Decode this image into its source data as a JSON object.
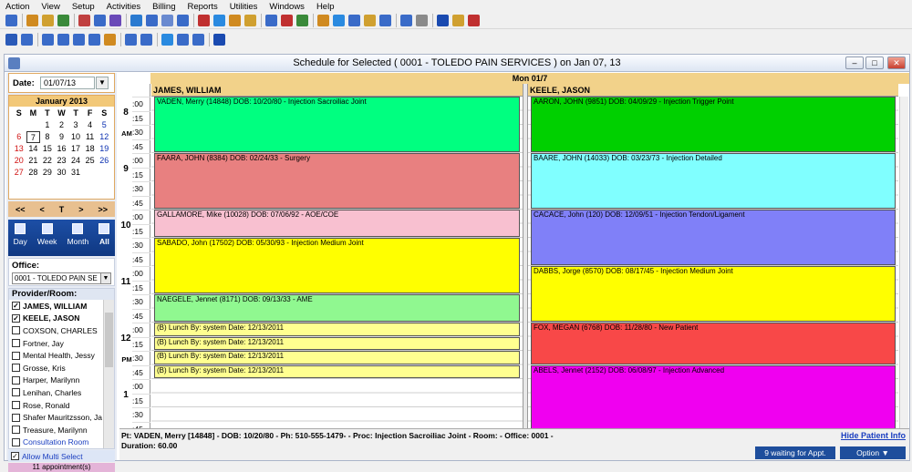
{
  "menu": [
    "Action",
    "View",
    "Setup",
    "Activities",
    "Billing",
    "Reports",
    "Utilities",
    "Windows",
    "Help"
  ],
  "window": {
    "title": "Schedule for Selected ( 0001 - TOLEDO PAIN SERVICES ) on Jan 07, 13"
  },
  "left": {
    "date_label": "Date:",
    "date_value": "01/07/13",
    "calendar": {
      "month": "January 2013",
      "weekdays": [
        "S",
        "M",
        "T",
        "W",
        "T",
        "F",
        "S"
      ],
      "weeks": [
        [
          "",
          "",
          "1",
          "2",
          "3",
          "4",
          "5"
        ],
        [
          "6",
          "7",
          "8",
          "9",
          "10",
          "11",
          "12"
        ],
        [
          "13",
          "14",
          "15",
          "16",
          "17",
          "18",
          "19"
        ],
        [
          "20",
          "21",
          "22",
          "23",
          "24",
          "25",
          "26"
        ],
        [
          "27",
          "28",
          "29",
          "30",
          "31",
          "",
          ""
        ]
      ],
      "selected": "7"
    },
    "nav": [
      "<<",
      "<",
      "T",
      ">",
      ">>"
    ],
    "views": [
      "Day",
      "Week",
      "Month",
      "All"
    ],
    "office_label": "Office:",
    "office_value": "0001 - TOLEDO PAIN SE",
    "provider_label": "Provider/Room:",
    "providers": [
      {
        "name": "JAMES, WILLIAM",
        "checked": true,
        "style": "bold"
      },
      {
        "name": "KEELE, JASON",
        "checked": true,
        "style": "bold"
      },
      {
        "name": "COXSON, CHARLES",
        "checked": false,
        "style": ""
      },
      {
        "name": "Fortner, Jay",
        "checked": false,
        "style": ""
      },
      {
        "name": "Mental Health, Jessy",
        "checked": false,
        "style": ""
      },
      {
        "name": "Grosse, Kris",
        "checked": false,
        "style": ""
      },
      {
        "name": "Harper, Marilynn",
        "checked": false,
        "style": ""
      },
      {
        "name": "Lenihan, Charles",
        "checked": false,
        "style": ""
      },
      {
        "name": "Rose, Ronald",
        "checked": false,
        "style": ""
      },
      {
        "name": "Shafer Mauritzsson, Ja",
        "checked": false,
        "style": ""
      },
      {
        "name": "Treasure, Marilynn",
        "checked": false,
        "style": ""
      },
      {
        "name": "Consultation Room",
        "checked": false,
        "style": "blue"
      }
    ],
    "allow_multi": "Allow Multi Select",
    "appointments": "11 appointment(s)"
  },
  "schedule": {
    "day": "Mon 01/7",
    "hours": [
      {
        "hour": "8",
        "ampm": "AM"
      },
      {
        "hour": "9",
        "ampm": ""
      },
      {
        "hour": "10",
        "ampm": ""
      },
      {
        "hour": "11",
        "ampm": ""
      },
      {
        "hour": "12",
        "ampm": "PM"
      },
      {
        "hour": "1",
        "ampm": ""
      }
    ],
    "minutes": [
      ":00",
      ":15",
      ":30",
      ":45"
    ],
    "providers": [
      {
        "name": "JAMES, WILLIAM",
        "appointments": [
          {
            "start": 0,
            "slots": 4,
            "color": "#00ff80",
            "text": "VADEN, Merry  (14848)  DOB: 10/20/80 -  Injection Sacroiliac Joint"
          },
          {
            "start": 4,
            "slots": 4,
            "color": "#e88080",
            "text": "FAARA, JOHN  (8384)  DOB: 02/24/33 -  Surgery"
          },
          {
            "start": 8,
            "slots": 2,
            "color": "#f8c0d0",
            "text": "GALLAMORE, Mike  (10028)  DOB: 07/06/92 -  AOE/COE"
          },
          {
            "start": 10,
            "slots": 4,
            "color": "#ffff00",
            "text": "SABADO, John  (17502)  DOB: 05/30/93 -  Injection Medium Joint"
          },
          {
            "start": 14,
            "slots": 2,
            "color": "#90f890",
            "text": "NAEGELE, Jennet  (8171)  DOB: 09/13/33 -  AME"
          },
          {
            "start": 16,
            "slots": 1,
            "color": "#ffff90",
            "text": "(B) Lunch  By: system  Date: 12/13/2011"
          },
          {
            "start": 17,
            "slots": 1,
            "color": "#ffff90",
            "text": "(B) Lunch  By: system  Date: 12/13/2011"
          },
          {
            "start": 18,
            "slots": 1,
            "color": "#ffff90",
            "text": "(B) Lunch  By: system  Date: 12/13/2011"
          },
          {
            "start": 19,
            "slots": 1,
            "color": "#ffff90",
            "text": "(B) Lunch  By: system  Date: 12/13/2011"
          }
        ]
      },
      {
        "name": "KEELE, JASON",
        "appointments": [
          {
            "start": 0,
            "slots": 4,
            "color": "#00d000",
            "text": "AARON, JOHN  (9851)  DOB: 04/09/29 -  Injection Trigger Point"
          },
          {
            "start": 4,
            "slots": 4,
            "color": "#80ffff",
            "text": "BAARE, JOHN  (14033)  DOB: 03/23/73 -  Injection Detailed"
          },
          {
            "start": 8,
            "slots": 4,
            "color": "#8080f8",
            "text": "CACACE, John  (120)  DOB: 12/09/51 -  Injection Tendon/Ligament"
          },
          {
            "start": 12,
            "slots": 4,
            "color": "#ffff00",
            "text": "DABBS, Jorge  (8570)  DOB: 08/17/45 -  Injection Medium Joint"
          },
          {
            "start": 16,
            "slots": 3,
            "color": "#f84848",
            "text": "FOX, MEGAN  (6768)  DOB: 11/28/80 -  New Patient"
          },
          {
            "start": 19,
            "slots": 5,
            "color": "#f000f0",
            "text": "ABELS, Jennet  (2152)  DOB: 06/08/97 -  Injection Advanced"
          }
        ]
      }
    ]
  },
  "status": {
    "line1": "Pt: VADEN, Merry  [14848] - DOB: 10/20/80 - Ph: 510-555-1479-  - Proc: Injection Sacroiliac Joint - Room:   - Office: 0001  -",
    "line2": "Duration: 60.00",
    "hide_link": "Hide Patient Info",
    "waiting": "9 waiting for Appt.",
    "option": "Option ▼"
  },
  "toolbar_colors": {
    "row1": [
      "#3a6bc8",
      "#d08a20",
      "#d0a030",
      "#3a8a3a",
      "#c04040",
      "#3a6bc8",
      "#6a4ab8",
      "#2a7ad0",
      "#3a6bc8",
      "#6a8ad0",
      "#3a6bc8",
      "#c03030",
      "#2a8ae0",
      "#d08a20",
      "#d0a030",
      "#3a6bc8",
      "#c03030",
      "#3a8a3a",
      "#d08a20",
      "#2a8ae0",
      "#3a6bc8",
      "#d0a030",
      "#3a6bc8",
      "#3a6bc8",
      "#8a8a8a",
      "#1a4ab0",
      "#d0a030",
      "#c03030"
    ],
    "row2": [
      "#2a5ab8",
      "#3a6bc8",
      "#3a6bc8",
      "#3a6bc8",
      "#3a6bc8",
      "#3a6bc8",
      "#d08a20",
      "#3a6bc8",
      "#3a6bc8",
      "#2a8ae0",
      "#3a6bc8",
      "#3a6bc8",
      "#1a4ab0"
    ]
  }
}
